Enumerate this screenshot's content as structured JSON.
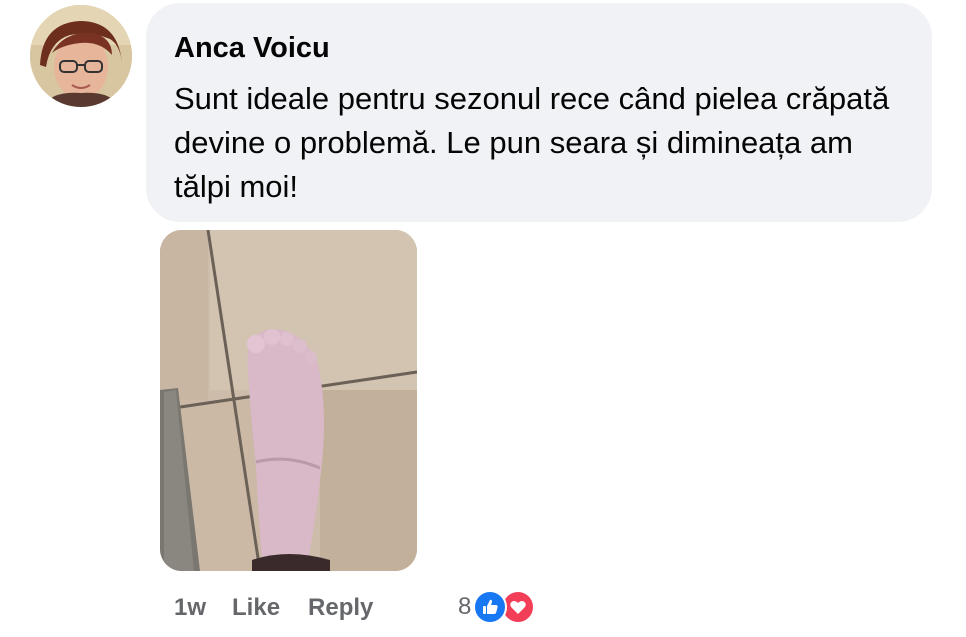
{
  "comment": {
    "author": "Anca Voicu",
    "text": "Sunt ideale pentru sezonul rece când pielea crăpată devine o problemă. Le pun seara și dimineața am tălpi moi!",
    "avatar_icon": "user-avatar-photo",
    "attachment_icon": "foot-photo"
  },
  "actions": {
    "time": "1w",
    "like_label": "Like",
    "reply_label": "Reply"
  },
  "reactions": {
    "count": "8",
    "icons": [
      "like-reaction-icon",
      "love-reaction-icon"
    ],
    "colors": {
      "like": "#1877f2",
      "love": "#f33e58"
    }
  },
  "theme": {
    "bubble_bg": "#f0f2f5",
    "text_color": "#050505",
    "meta_color": "#65676b"
  }
}
